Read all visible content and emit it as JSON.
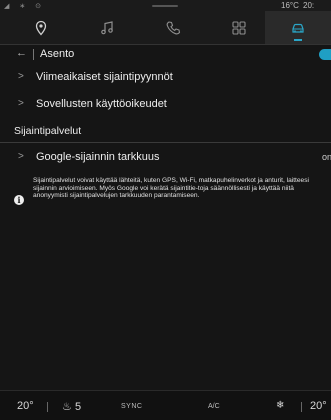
{
  "status": {
    "temperature": "16°C",
    "time": "20:"
  },
  "nav": {
    "tabs": [
      "location-pin-icon",
      "music-icon",
      "phone-icon",
      "apps-icon",
      "car-icon"
    ],
    "active_tab": "car-icon"
  },
  "header": {
    "title": "Asento"
  },
  "menu": {
    "items": [
      {
        "label": "Viimeaikaiset sijaintipyynnöt"
      },
      {
        "label": "Sovellusten käyttöoikeudet"
      }
    ]
  },
  "location_services": {
    "section_title": "Sijaintipalvelut",
    "accuracy_label": "Google-sijainnin tarkkuus",
    "accuracy_value": "on",
    "info_text": "Sijaintipalvelut voivat käyttää lähteitä, kuten GPS, Wi-Fi, matkapuhelinverkot ja anturit, laitteesi sijainnin arvioimiseen. Myös Google voi kerätä sijaintitie-toja säännöllisesti ja käyttää niitä anonyymisti sijaintipalvelujen tarkkuuden parantamiseen."
  },
  "climate": {
    "driver_temp": "20°",
    "seat_heat_level": "5",
    "sync_label": "SYNC",
    "ac_label": "A/C",
    "passenger_temp": "20°"
  },
  "colors": {
    "accent": "#2aa6c8",
    "background": "#151515"
  }
}
